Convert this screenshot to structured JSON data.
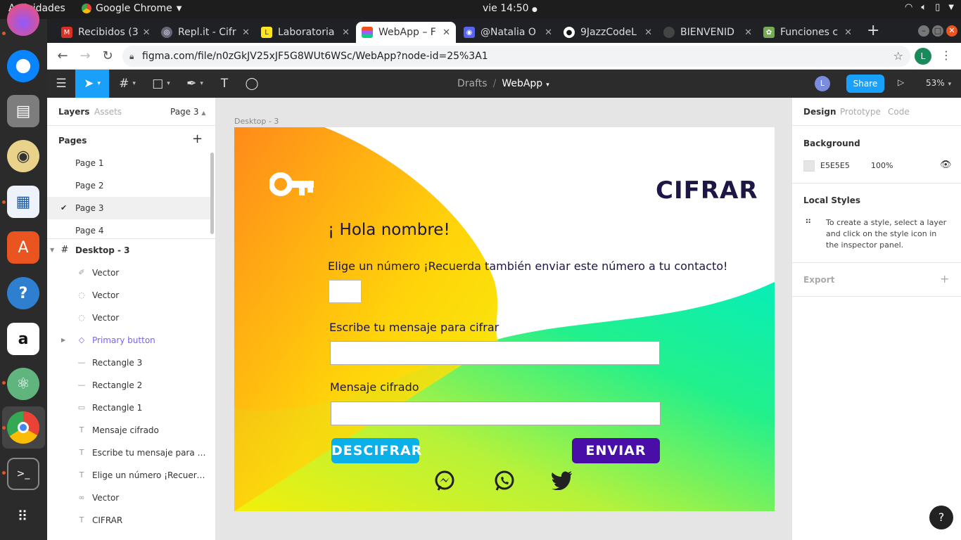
{
  "os": {
    "activities": "Actividades",
    "app_name": "Google Chrome",
    "clock": "vie 14:50"
  },
  "dock": {
    "items": [
      "thunderbird-icon",
      "files-icon",
      "music-icon",
      "writer-icon",
      "software-icon",
      "help-icon",
      "amazon-icon",
      "atom-icon",
      "chrome-icon",
      "terminal-icon",
      "apps-grid-icon"
    ]
  },
  "browser": {
    "tabs": [
      {
        "label": "Recibidos (3",
        "icon": "gmail-icon",
        "color": "#d93025"
      },
      {
        "label": "Repl.it - Cifr",
        "icon": "replit-icon",
        "color": "#667"
      },
      {
        "label": "Laboratoria",
        "icon": "laboratoria-icon",
        "color": "#ffe521"
      },
      {
        "label": "WebApp – F",
        "icon": "figma-icon",
        "color": "#f24e1e"
      },
      {
        "label": "@Natalia O",
        "icon": "discord-icon",
        "color": "#5865f2"
      },
      {
        "label": "9JazzCodeL",
        "icon": "github-icon",
        "color": "#333"
      },
      {
        "label": "BIENVENID",
        "icon": "page-icon",
        "color": "#555"
      },
      {
        "label": "Funciones c",
        "icon": "plant-icon",
        "color": "#7a5"
      }
    ],
    "url": "figma.com/file/n0zGkJV25xJF5G8WUt6WSc/WebApp?node-id=25%3A1",
    "profile_initial": "L"
  },
  "figma": {
    "breadcrumb_project": "Drafts",
    "breadcrumb_file": "WebApp",
    "user_initial": "L",
    "share_label": "Share",
    "zoom": "53%",
    "left_tabs": {
      "layers": "Layers",
      "assets": "Assets",
      "page": "Page 3"
    },
    "pages_title": "Pages",
    "pages": [
      "Page 1",
      "Page 2",
      "Page 3",
      "Page 4"
    ],
    "selected_page": "Page 3",
    "layers": [
      {
        "name": "Desktop - 3",
        "type": "frame"
      },
      {
        "name": "Vector",
        "type": "vector"
      },
      {
        "name": "Vector",
        "type": "vector"
      },
      {
        "name": "Vector",
        "type": "vector"
      },
      {
        "name": "Primary button",
        "type": "component"
      },
      {
        "name": "Rectangle 3",
        "type": "line"
      },
      {
        "name": "Rectangle 2",
        "type": "line"
      },
      {
        "name": "Rectangle 1",
        "type": "rect"
      },
      {
        "name": "Mensaje cifrado",
        "type": "text"
      },
      {
        "name": "Escribe tu mensaje para cifrar",
        "type": "text"
      },
      {
        "name": "Elige un número ¡Recuerda ta...",
        "type": "text"
      },
      {
        "name": "Vector",
        "type": "vector"
      },
      {
        "name": "CIFRAR",
        "type": "text"
      }
    ],
    "frame_name": "Desktop - 3",
    "design": {
      "title": "CIFRAR",
      "greeting": "¡ Hola nombre!",
      "prompt": "Elige un número ¡Recuerda también enviar este número a tu contacto!",
      "message_label": "Escribe tu mensaje para cifrar",
      "encrypted_label": "Mensaje cifrado",
      "decrypt_button": "DESCIFRAR",
      "send_button": "ENVIAR",
      "social_icons": [
        "messenger-icon",
        "whatsapp-icon",
        "twitter-icon"
      ]
    },
    "right_tabs": {
      "design": "Design",
      "prototype": "Prototype",
      "code": "Code"
    },
    "background_title": "Background",
    "background_hex": "E5E5E5",
    "background_opacity": "100%",
    "local_styles_title": "Local Styles",
    "local_styles_text": "To create a style, select a layer and click on the style icon in the inspector panel.",
    "export_title": "Export",
    "help": "?"
  },
  "colors": {
    "figma_blue": "#18a0fb",
    "descifrar": "#0cb0e8",
    "enviar": "#4a0ea8",
    "title_navy": "#1e1645"
  }
}
